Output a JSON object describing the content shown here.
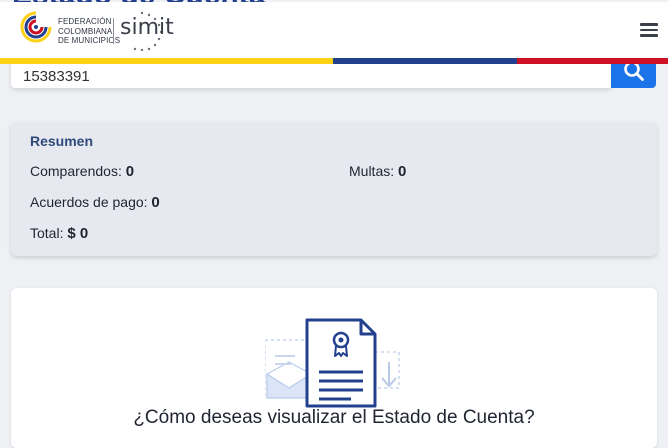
{
  "page": {
    "title_peek": "Estado de Cuenta"
  },
  "header": {
    "federation_lines": [
      "FEDERACIÓN",
      "COLOMBIANA",
      "DE MUNICIPIOS"
    ],
    "simit_label": "simit",
    "stripe_colors": [
      "#fcd116",
      "#23408e",
      "#ce1126"
    ]
  },
  "search": {
    "value": "15383391",
    "button_icon": "search-icon",
    "accent": "#1a73e8"
  },
  "summary": {
    "title": "Resumen",
    "comparendos_label": "Comparendos:",
    "comparendos_value": "0",
    "multas_label": "Multas:",
    "multas_value": "0",
    "acuerdos_label": "Acuerdos de pago:",
    "acuerdos_value": "0",
    "total_label": "Total:",
    "total_value": "$ 0"
  },
  "visualize": {
    "question": "¿Cómo deseas visualizar el Estado de Cuenta?",
    "illustration_icon": "certificate-document-icon"
  }
}
